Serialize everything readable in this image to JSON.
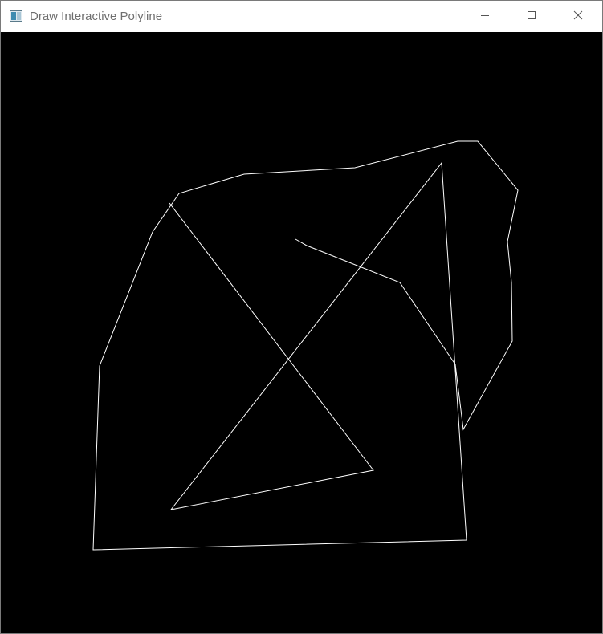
{
  "window": {
    "title": "Draw Interactive Polyline",
    "icon": "app-window-icon",
    "controls": {
      "minimize_icon": "minimize-icon",
      "maximize_icon": "maximize-icon",
      "close_icon": "close-icon"
    }
  },
  "canvas": {
    "background": "#000000",
    "stroke_color": "#ffffff"
  }
}
